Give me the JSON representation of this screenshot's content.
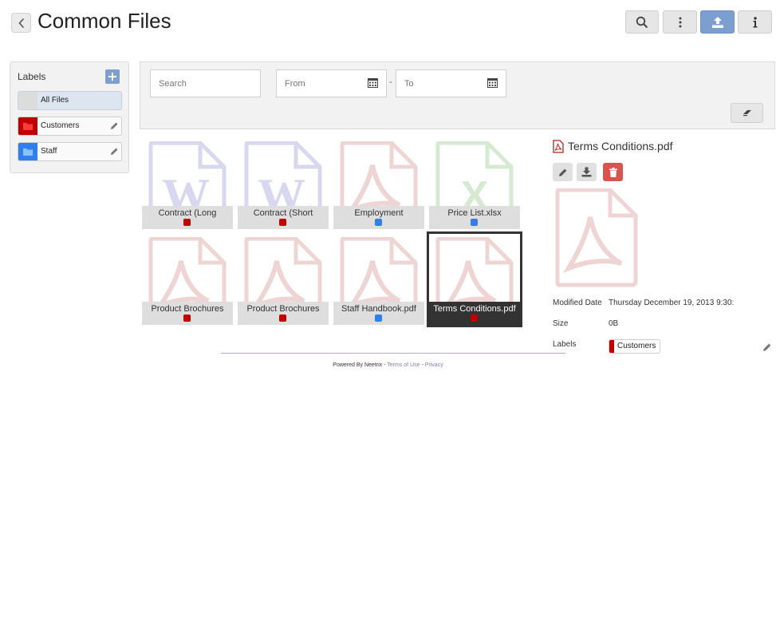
{
  "header": {
    "title": "Common Files",
    "toolbar": [
      {
        "name": "search-button",
        "icon": "search-icon"
      },
      {
        "name": "more-options-button",
        "icon": "vertical-dots-icon"
      },
      {
        "name": "upload-button",
        "icon": "upload-icon"
      },
      {
        "name": "info-button",
        "icon": "info-icon"
      }
    ]
  },
  "sidebar": {
    "heading": "Labels",
    "items": [
      {
        "label": "All Files",
        "color": "#dde6f0"
      },
      {
        "label": "Customers",
        "color": "#c00000"
      },
      {
        "label": "Staff",
        "color": "#2f7ff0"
      }
    ]
  },
  "filters": {
    "search_placeholder": "Search",
    "from_placeholder": "From",
    "to_placeholder": "To",
    "separator": "-"
  },
  "files": [
    {
      "name": "Contract (Long",
      "type": "word",
      "label_color": "#c00000"
    },
    {
      "name": "Contract (Short",
      "type": "word",
      "label_color": "#c00000"
    },
    {
      "name": "Employment",
      "type": "pdf",
      "label_color": "#2f7ff0"
    },
    {
      "name": "Price List.xlsx",
      "type": "excel",
      "label_color": "#2f7ff0"
    },
    {
      "name": "Product Brochures",
      "type": "pdf",
      "label_color": "#c00000"
    },
    {
      "name": "Product Brochures",
      "type": "pdf",
      "label_color": "#c00000"
    },
    {
      "name": "Staff Handbook.pdf",
      "type": "pdf",
      "label_color": "#2f7ff0"
    },
    {
      "name": "Terms Conditions.pdf",
      "type": "pdf",
      "label_color": "#c00000",
      "selected": true
    }
  ],
  "details": {
    "title": "Terms Conditions.pdf",
    "modified_key": "Modified Date",
    "modified_value": "Thursday December 19, 2013 9:30:",
    "size_key": "Size",
    "size_value": "0B",
    "labels_key": "Labels",
    "label_value": "Customers"
  },
  "footer": {
    "powered": "Powered By Neetrix -",
    "terms": "Terms of Use",
    "sep": "-",
    "privacy": "Privacy"
  },
  "colors": {
    "accent": "#7d9fcf",
    "customers": "#c00000",
    "staff": "#2f7ff0",
    "danger": "#d9534f"
  }
}
